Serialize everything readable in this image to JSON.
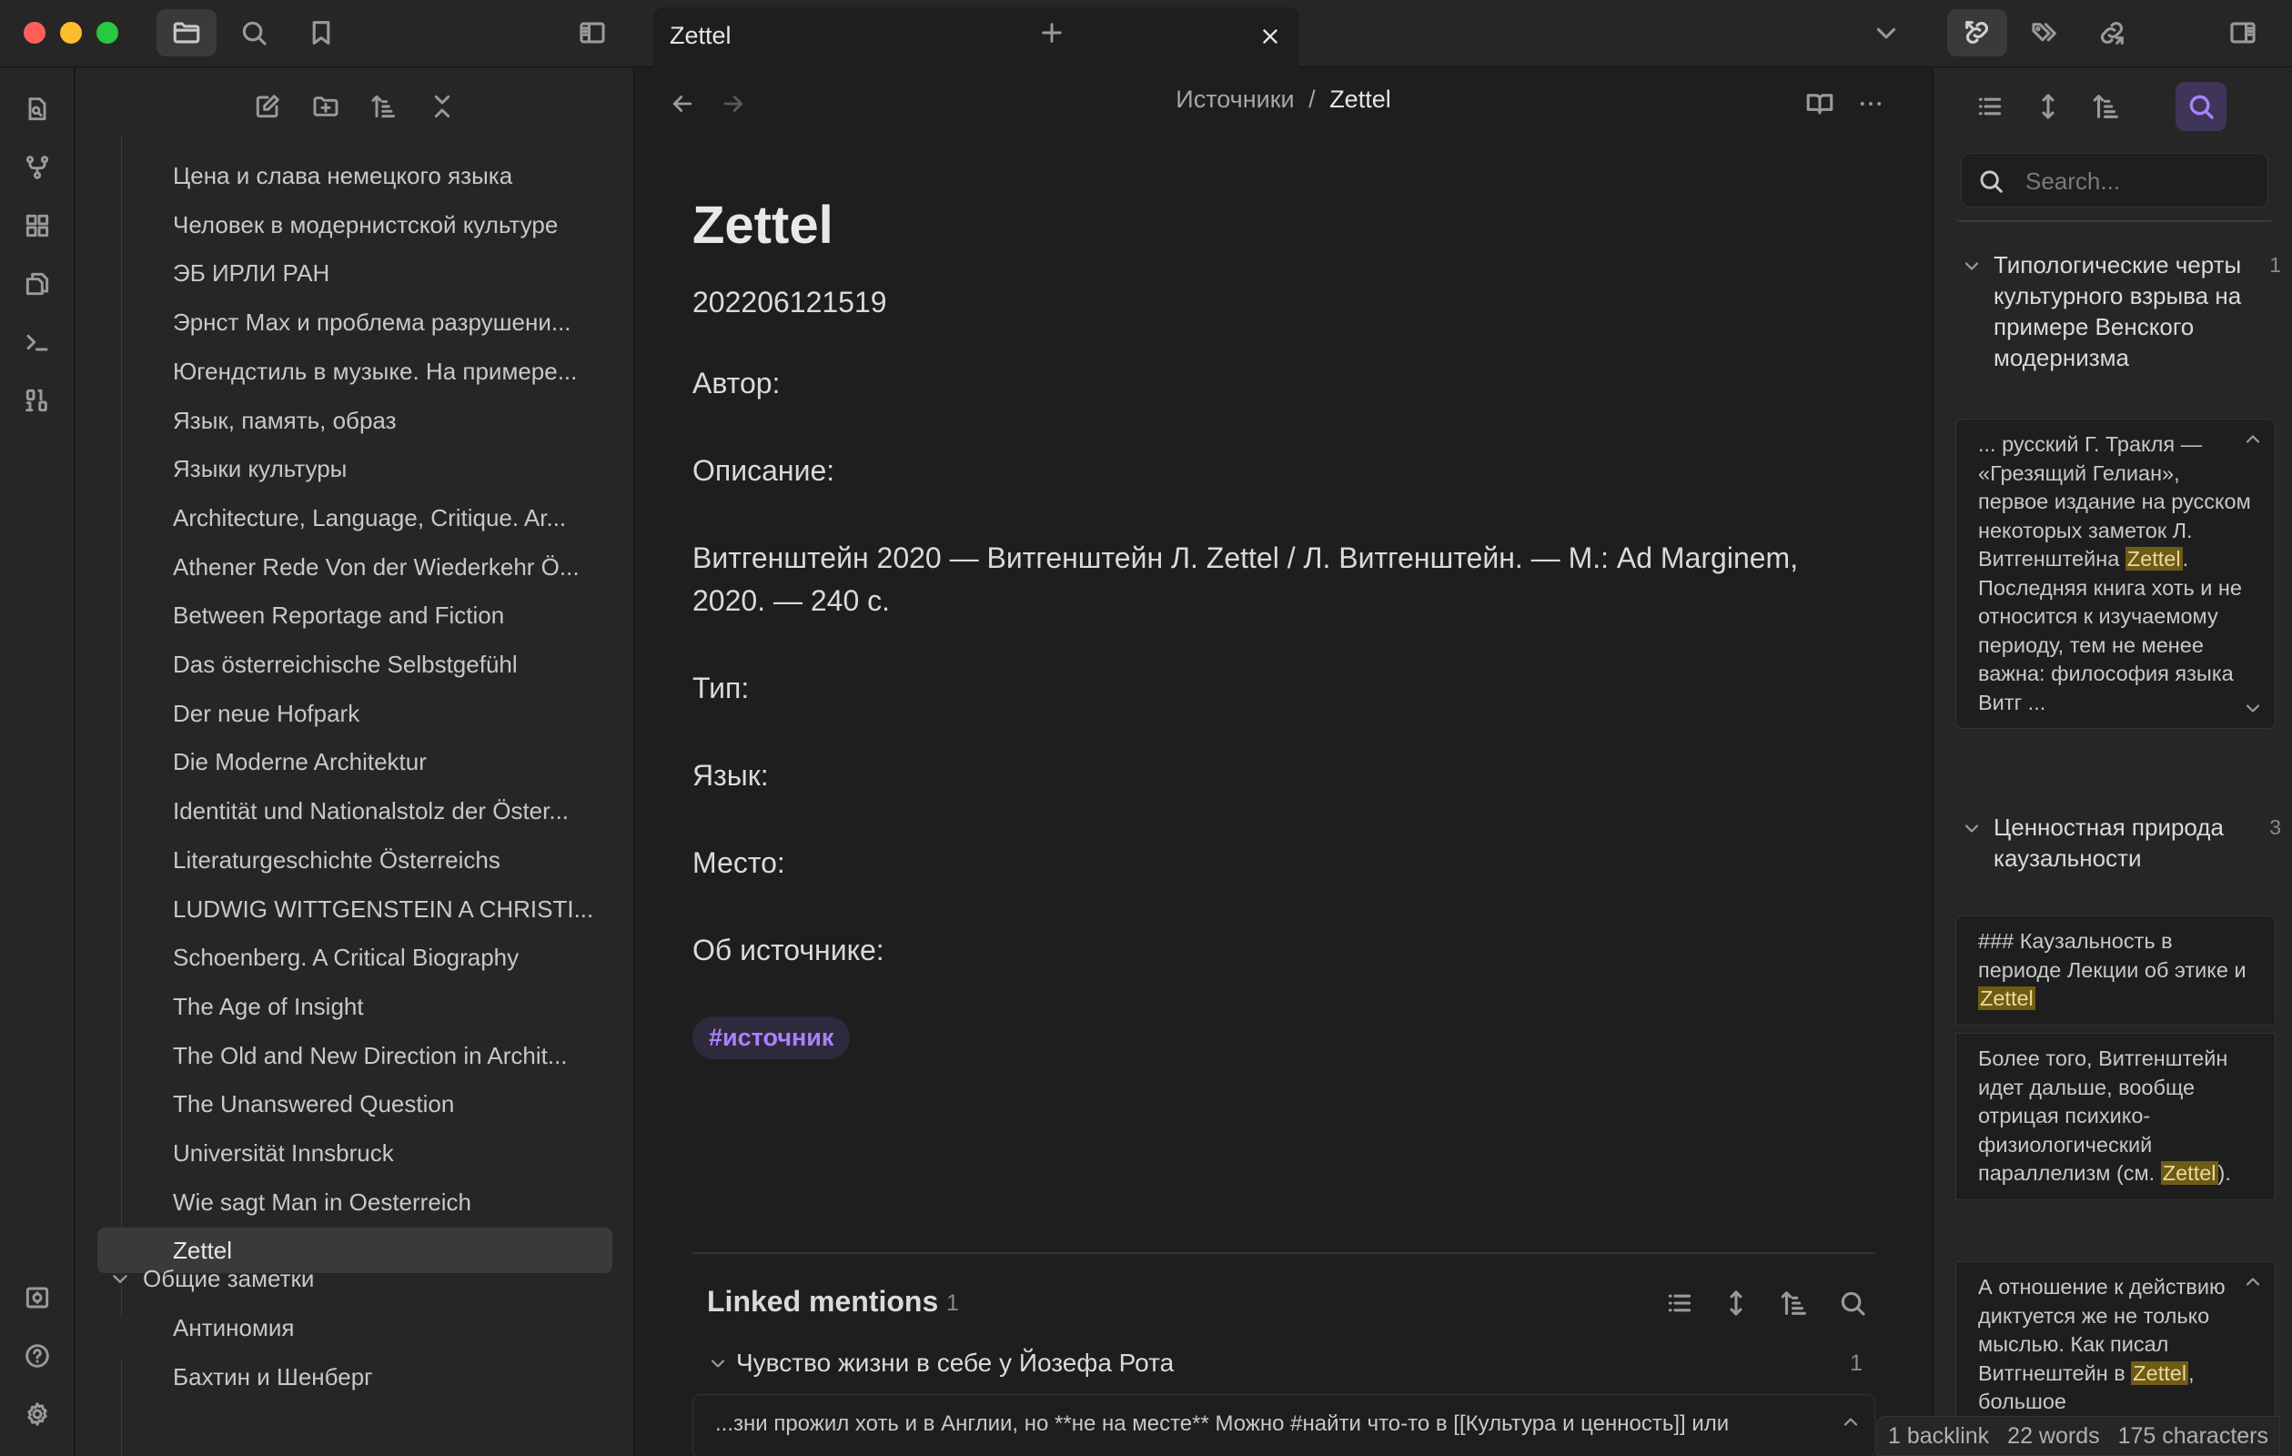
{
  "tab": {
    "title": "Zettel"
  },
  "explorer": {
    "files": [
      "Цена и слава немецкого языка",
      "Человек в модернистской культуре",
      "ЭБ ИРЛИ РАН",
      "Эрнст Мах и проблема разрушени...",
      "Югендстиль в музыке. На примере...",
      "Язык, память, образ",
      "Языки культуры",
      "Architecture, Language, Critique. Ar...",
      "Athener Rede Von der Wiederkehr Ö...",
      "Between Reportage and Fiction",
      "Das österreichische Selbstgefühl",
      "Der neue Hofpark",
      "Die Moderne Architektur",
      "Identität und Nationalstolz der Öster...",
      "Literaturgeschichte Österreichs",
      "LUDWIG WITTGENSTEIN A CHRISTI...",
      "Schoenberg. A Critical Biography",
      "The Age of Insight",
      "The Old and New Direction in Archit...",
      "The Unanswered Question",
      "Universität Innsbruck",
      "Wie sagt Man in Oesterreich",
      "Zettel"
    ],
    "active_file": "Zettel",
    "folder": "Общие заметки",
    "folder_files": [
      "Антиномия",
      "Бахтин и Шенберг"
    ]
  },
  "editor": {
    "breadcrumb_parent": "Источники",
    "breadcrumb_sep": "/",
    "breadcrumb_current": "Zettel",
    "title": "Zettel",
    "note_id": "202206121519",
    "author": "Автор:",
    "description": "Описание:",
    "citation": "Витгенштейн 2020 — Витгенштейн Л. Zettel / Л. Витгенштейн. — М.: Ad Marginem, 2020. — 240 с.",
    "type": "Тип:",
    "language": "Язык:",
    "place": "Место:",
    "about": "Об источнике:",
    "tag": "#источник"
  },
  "linked_mentions": {
    "title": "Linked mentions",
    "count": "1",
    "group_title": "Чувство жизни в себе у Йозефа Рота",
    "group_count": "1",
    "snippet": "...зни прожил хоть и в Англии, но **не на месте** Можно #найти  что-то в [[Культура и ценность]] или"
  },
  "right_sidebar": {
    "search_placeholder": "Search...",
    "groups": [
      {
        "title": "Типологические черты культурного взрыва на примере Венского модернизма",
        "count": "1"
      },
      {
        "title": "Ценностная природа каузальности",
        "count": "3"
      }
    ],
    "card1": {
      "before": "... русский Г. Тракля — «Грезящий Гелиан», первое издание на русском некоторых заметок Л. Витгенштейна ",
      "highlight": "Zettel",
      "after": ". Последняя книга хоть и не относится к изучаемому периоду, тем не менее важна: философия языка Витг ..."
    },
    "card2": {
      "before": "### Каузальность в периоде Лекции об этике и ",
      "highlight": "Zettel",
      "after": ""
    },
    "card3": {
      "before": "Более того, Витгенштейн идет дальше, вообще отрицая психико-физиологический параллелизм (см. ",
      "highlight": "Zettel",
      "after": ")."
    },
    "card4": {
      "before": "А отношение к действию диктуется же не только мыслью. Как писал Витгнештейн в ",
      "highlight": "Zettel",
      "after": ", большое"
    }
  },
  "status": {
    "backlinks": "1 backlink",
    "words": "22 words",
    "characters": "175 characters"
  },
  "colors": {
    "accent": "#a882ff",
    "highlight": "#6e5c14",
    "bg": "#1e1e1e",
    "panel": "#262626"
  }
}
